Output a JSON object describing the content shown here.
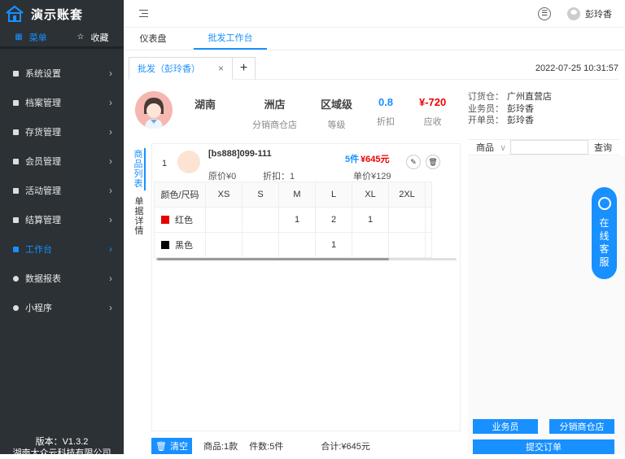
{
  "app": {
    "title": "演示账套",
    "version": "版本：V1.3.2",
    "company": "湖南大众云科技有限公司"
  },
  "sidebar": {
    "tabs": [
      {
        "label": "菜单",
        "icon": "grid-icon"
      },
      {
        "label": "收藏",
        "icon": "star-icon"
      }
    ],
    "items": [
      {
        "label": "系统设置"
      },
      {
        "label": "档案管理"
      },
      {
        "label": "存货管理"
      },
      {
        "label": "会员管理"
      },
      {
        "label": "活动管理"
      },
      {
        "label": "结算管理"
      },
      {
        "label": "工作台"
      },
      {
        "label": "数据报表"
      },
      {
        "label": "小程序"
      }
    ],
    "active_index": 6
  },
  "header": {
    "username": "彭玲香"
  },
  "page_tabs": [
    {
      "label": "仪表盘"
    },
    {
      "label": "批发工作台"
    }
  ],
  "doc_tab": {
    "label": "批发（彭玲香）",
    "close": "×",
    "add": "+"
  },
  "datetime": "2022-07-25 10:31:57",
  "customer": {
    "name": "湖南",
    "store": "洲店",
    "store_type": "分销商仓店",
    "level": "区域级",
    "level_label": "等级",
    "discount": "0.8",
    "discount_label": "折扣",
    "receivable": "¥-720",
    "receivable_label": "应收"
  },
  "order_info": {
    "warehouse_label": "订货仓：",
    "warehouse": "广州直营店",
    "salesman_label": "业务员：",
    "salesman": "彭玲香",
    "creator_label": "开单员：",
    "creator": "彭玲香"
  },
  "vtabs": [
    {
      "label": "商品列表"
    },
    {
      "label": "单据详情"
    }
  ],
  "product": {
    "index": "1",
    "code": "[bs888]099-111",
    "qty": "5件",
    "amount": "¥645元",
    "orig_price": "原价¥0",
    "discount": "折扣：1",
    "unit_price": "单价¥129"
  },
  "size_table": {
    "headers": [
      "颜色/尺码",
      "XS",
      "S",
      "M",
      "L",
      "XL",
      "2XL"
    ],
    "rows": [
      {
        "color": "红色",
        "swatch": "#e60000",
        "cells": [
          "",
          "",
          "1",
          "2",
          "1",
          ""
        ]
      },
      {
        "color": "黑色",
        "swatch": "#000000",
        "cells": [
          "",
          "",
          "",
          "1",
          "",
          ""
        ]
      }
    ]
  },
  "bottom": {
    "clear": "清空",
    "items": "商品:1款",
    "count": "件数:5件",
    "total": "合计:¥645元"
  },
  "search": {
    "select": "商品",
    "button": "查询"
  },
  "online_service": "在线客服",
  "right_buttons": {
    "salesman": "业务员",
    "store": "分销商仓店",
    "submit": "提交订单"
  }
}
